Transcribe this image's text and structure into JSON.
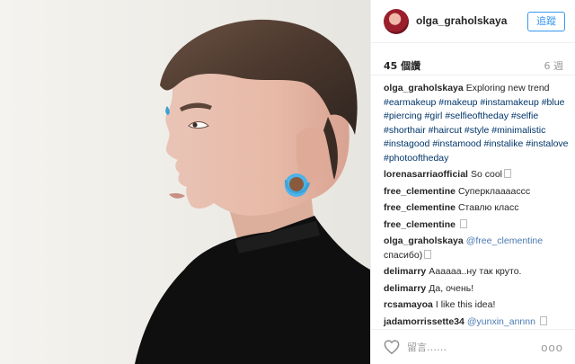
{
  "post": {
    "username": "olga_graholskaya",
    "follow_label": "追蹤",
    "likes": "45 個讚",
    "time": "6 週"
  },
  "caption": {
    "user": "olga_graholskaya",
    "text": "Exploring new trend",
    "hashtags": [
      "#earmakeup",
      "#makeup",
      "#instamakeup",
      "#blue",
      "#piercing",
      "#girl",
      "#selfieoftheday",
      "#selfie",
      "#shorthair",
      "#haircut",
      "#style",
      "#minimalistic",
      "#instagood",
      "#instamood",
      "#instalike",
      "#instalove",
      "#photooftheday"
    ]
  },
  "comments": [
    {
      "user": "lorenasarriaofficial",
      "text": "So cool",
      "emoji": true
    },
    {
      "user": "free_clementine",
      "text": "Суперклааааccс"
    },
    {
      "user": "free_clementine",
      "text": "Ставлю класс"
    },
    {
      "user": "free_clementine",
      "text": "",
      "emoji": true
    },
    {
      "user": "olga_graholskaya",
      "mention": "@free_clementine",
      "text": "спасибо)",
      "emoji": true
    },
    {
      "user": "delimarry",
      "text": "Аааааа..ну так круто."
    },
    {
      "user": "delimarry",
      "text": "Да, очень!"
    },
    {
      "user": "rcsamayoa",
      "text": "I like this idea!"
    },
    {
      "user": "jadamorrissette34",
      "mention": "@yunxin_annnn",
      "text": "",
      "emoji": true
    }
  ],
  "footer": {
    "comment_placeholder": "留言……",
    "more_label": "ooo"
  },
  "icons": {
    "like": "heart-icon",
    "more": "more-options-icon"
  },
  "colors": {
    "link": "#003569",
    "accent": "#3897f0",
    "earring": "#4db3e8"
  }
}
